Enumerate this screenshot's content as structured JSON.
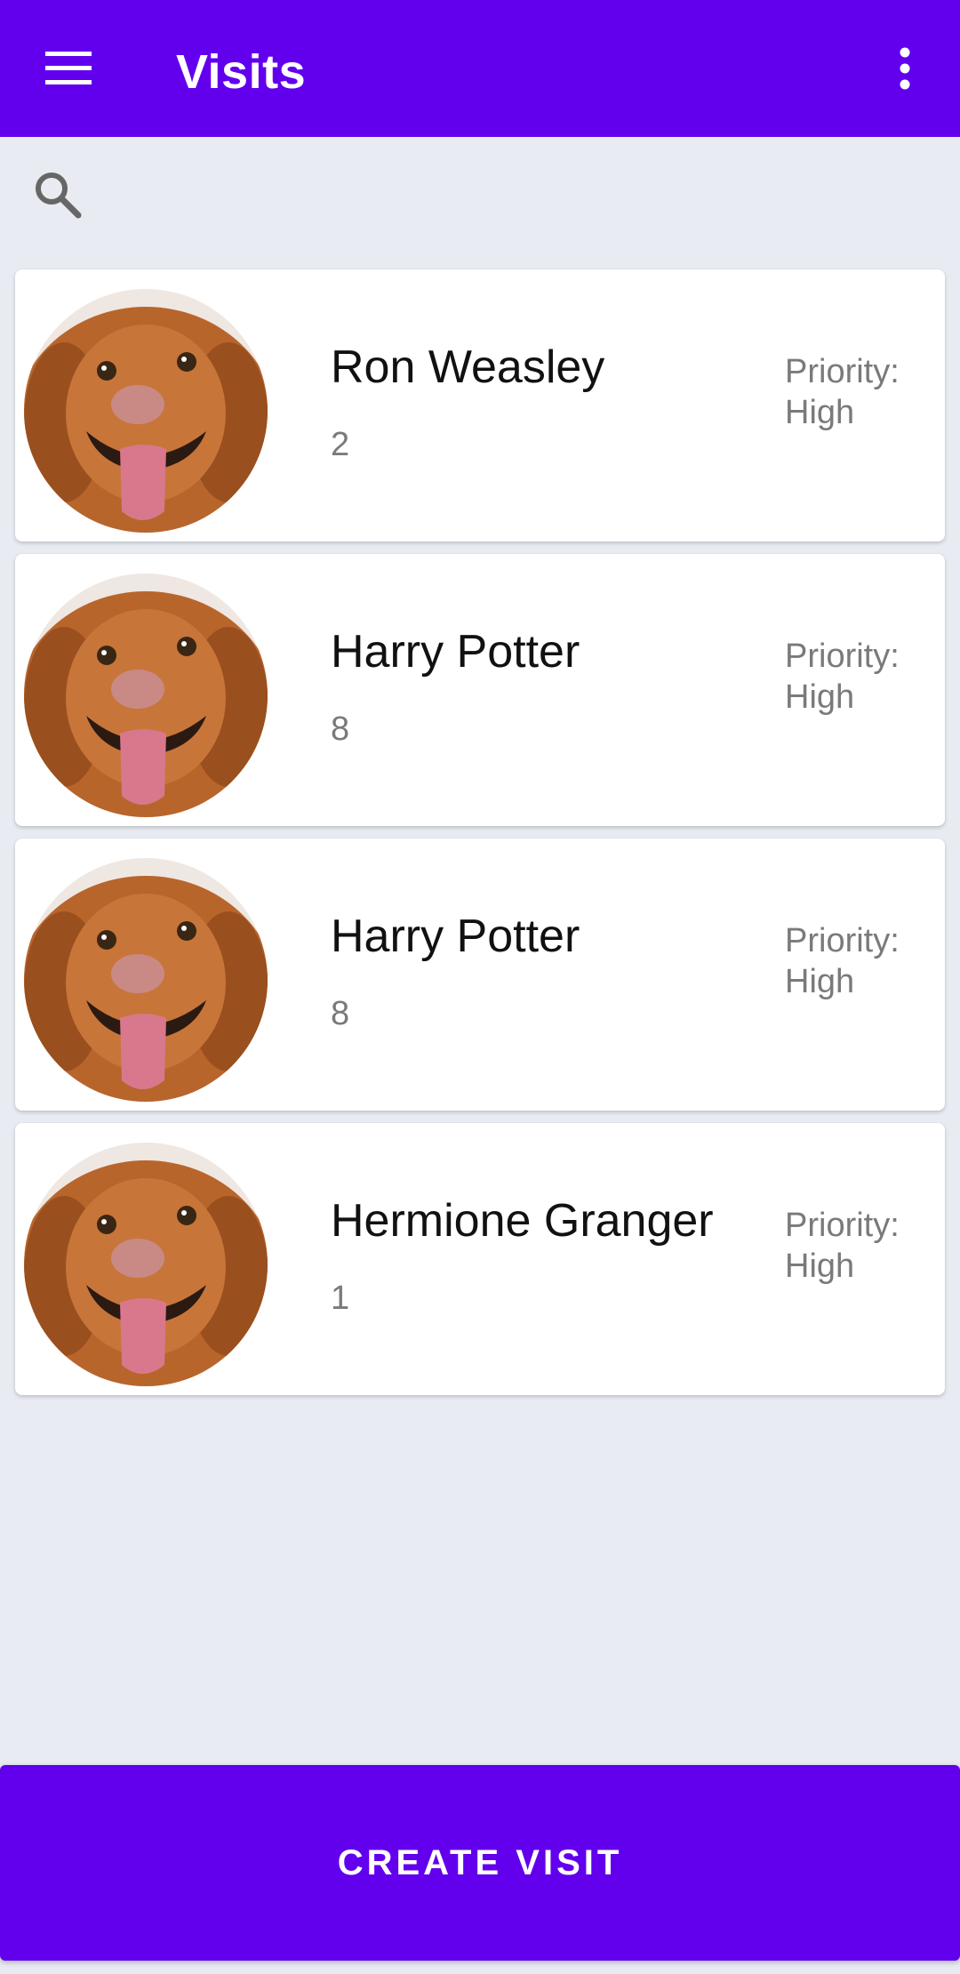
{
  "appbar": {
    "title": "Visits",
    "menu_icon": "menu-icon",
    "overflow_icon": "more-vert-icon",
    "color": "#6200ee"
  },
  "search": {
    "icon": "search-icon",
    "placeholder": "",
    "value": ""
  },
  "visits": [
    {
      "name": "Ron Weasley",
      "count": "2",
      "priority_label": "Priority:",
      "priority": "High"
    },
    {
      "name": "Harry Potter",
      "count": "8",
      "priority_label": "Priority:",
      "priority": "High"
    },
    {
      "name": "Harry Potter",
      "count": "8",
      "priority_label": "Priority:",
      "priority": "High"
    },
    {
      "name": "Hermione Granger",
      "count": "1",
      "priority_label": "Priority:",
      "priority": "High"
    }
  ],
  "footer": {
    "create_label": "CREATE VISIT"
  }
}
